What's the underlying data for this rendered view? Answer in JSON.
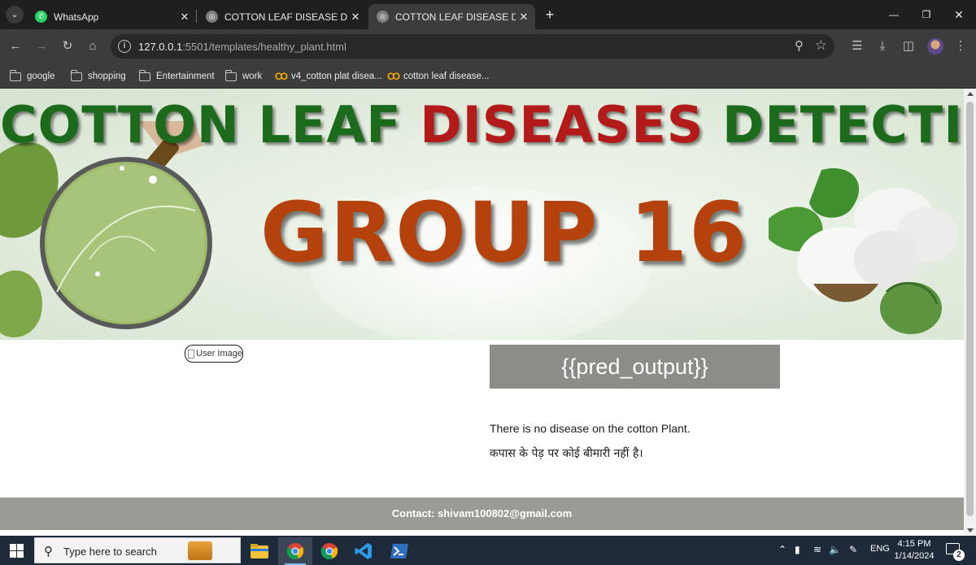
{
  "browser": {
    "tabs": [
      {
        "title": "WhatsApp",
        "favicon": "whatsapp-icon",
        "active": false
      },
      {
        "title": "COTTON LEAF DISEASE DETECT",
        "favicon": "globe-icon",
        "active": false
      },
      {
        "title": "COTTON LEAF DISEASE DETECT",
        "favicon": "globe-icon",
        "active": true
      }
    ],
    "url_host": "127.0.0.1",
    "url_rest": ":5501/templates/healthy_plant.html",
    "bookmarks": [
      {
        "label": "google",
        "icon": "folder-icon"
      },
      {
        "label": "shopping",
        "icon": "folder-icon"
      },
      {
        "label": "Entertainment",
        "icon": "folder-icon"
      },
      {
        "label": "work",
        "icon": "folder-icon"
      },
      {
        "label": "v4_cotton plat disea...",
        "icon": "colab-icon"
      },
      {
        "label": "cotton leaf disease...",
        "icon": "colab-icon"
      }
    ]
  },
  "page": {
    "banner": {
      "title_part1": "COTTON LEAF ",
      "title_part2": "DISEASES",
      "title_part3": " DETECTION",
      "subtitle": "GROUP 16"
    },
    "user_image_alt": "User Image",
    "pred_output": "{{pred_output}}",
    "message_en": "There is no disease on the cotton Plant.",
    "message_hi": "कपास के पेड़ पर कोई बीमारी नहीं है।",
    "footer": "Contact: shivam100802@gmail.com"
  },
  "taskbar": {
    "search_placeholder": "Type here to search",
    "lang": "ENG",
    "time": "4:15 PM",
    "date": "1/14/2024",
    "notification_count": "2"
  },
  "colors": {
    "title_green": "#1c6b1d",
    "title_red": "#b31b1b",
    "group_orange": "#b5420d",
    "pred_box_bg": "#8c8c89",
    "footer_bg": "#9b9b96"
  }
}
